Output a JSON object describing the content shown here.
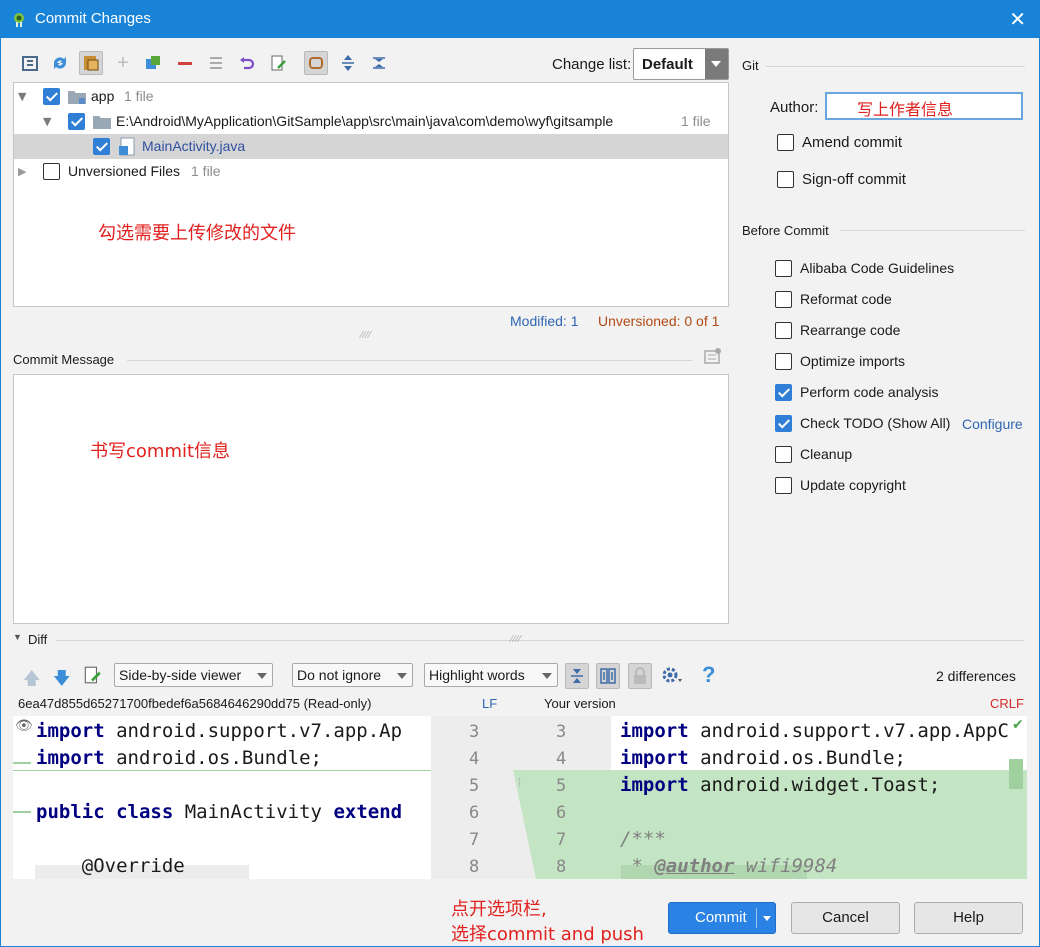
{
  "window": {
    "title": "Commit Changes"
  },
  "toolbar": {
    "change_list_label": "Change list:",
    "change_list_value": "Default"
  },
  "tree": {
    "items": [
      {
        "label": "app",
        "count": "1 file"
      },
      {
        "label": "E:\\Android\\MyApplication\\GitSample\\app\\src\\main\\java\\com\\demo\\wyf\\gitsample",
        "count": "1 file"
      },
      {
        "label": "MainActivity.java"
      },
      {
        "label": "Unversioned Files",
        "count": "1 file"
      }
    ],
    "annotation": "勾选需要上传修改的文件"
  },
  "status": {
    "modified": "Modified: 1",
    "unversioned": "Unversioned: 0 of 1"
  },
  "commit_message": {
    "label": "Commit Message",
    "annotation": "书写commit信息"
  },
  "git": {
    "section_label": "Git",
    "author_label": "Author:",
    "author_value": "写上作者信息",
    "amend": "Amend commit",
    "signoff": "Sign-off commit"
  },
  "before_commit": {
    "section_label": "Before Commit",
    "items": [
      {
        "label": "Alibaba Code Guidelines",
        "checked": false
      },
      {
        "label": "Reformat code",
        "checked": false
      },
      {
        "label": "Rearrange code",
        "checked": false
      },
      {
        "label": "Optimize imports",
        "checked": false
      },
      {
        "label": "Perform code analysis",
        "checked": true
      },
      {
        "label": "Check TODO (Show All)",
        "checked": true
      },
      {
        "label": "Cleanup",
        "checked": false
      },
      {
        "label": "Update copyright",
        "checked": false
      }
    ],
    "configure_link": "Configure"
  },
  "diff": {
    "section_label": "Diff",
    "viewer": "Side-by-side viewer",
    "ignore": "Do not ignore",
    "highlight": "Highlight words",
    "differences": "2 differences",
    "left_header": "6ea47d855d65271700fbedef6a5684646290dd75 (Read-only)",
    "left_eol": "LF",
    "right_header": "Your version",
    "right_eol": "CRLF",
    "left_numbers": [
      "3",
      "4",
      "5",
      "6",
      "7",
      "8"
    ],
    "right_numbers": [
      "3",
      "4",
      "5",
      "6",
      "7",
      "8"
    ]
  },
  "buttons": {
    "commit": "Commit",
    "cancel": "Cancel",
    "help": "Help"
  },
  "bottom_annotation": {
    "line1": "点开选项栏,",
    "line2": "选择commit and push"
  },
  "colors": {
    "titlebar": "#1883d7",
    "primary_button": "#2a82e4",
    "diff_added": "#c4e5c3",
    "link": "#2f66b3",
    "warn": "#b04a14"
  }
}
